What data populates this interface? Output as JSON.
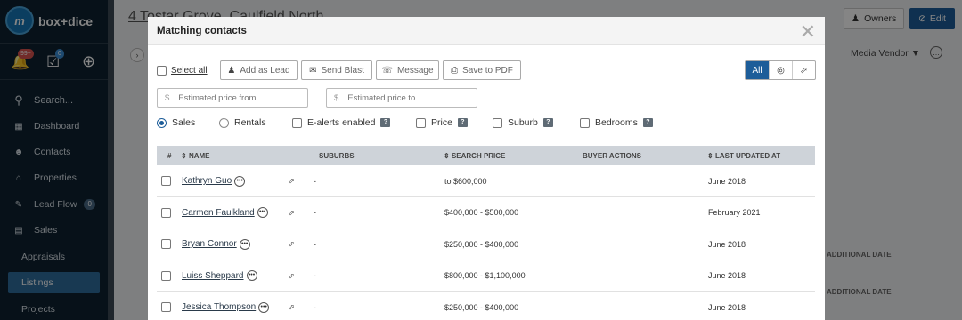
{
  "brand": {
    "logo_text": "m",
    "name": "box+dice"
  },
  "notifications": {
    "bell_count": "99+",
    "tasks_count": "0"
  },
  "sidebar": {
    "items": [
      {
        "label": "Search...",
        "icon": "search-icon"
      },
      {
        "label": "Dashboard",
        "icon": "dashboard-icon"
      },
      {
        "label": "Contacts",
        "icon": "contacts-icon"
      },
      {
        "label": "Properties",
        "icon": "home-icon"
      },
      {
        "label": "Lead Flow",
        "icon": "leadflow-icon",
        "count": "0"
      },
      {
        "label": "Sales",
        "icon": "sales-icon"
      }
    ],
    "subitems": [
      {
        "label": "Appraisals"
      },
      {
        "label": "Listings",
        "active": true
      },
      {
        "label": "Projects"
      }
    ]
  },
  "background": {
    "property_title": "4 Tostar Grove, Caulfield North",
    "owners_label": "Owners",
    "edit_label": "Edit",
    "media_vendor_label": "Media Vendor",
    "additional_date_1": "ADDITIONAL DATE",
    "additional_date_2": "ADDITIONAL DATE"
  },
  "modal": {
    "title": "Matching contacts",
    "select_all": "Select all",
    "buttons": {
      "add_as_lead": "Add as Lead",
      "send_blast": "Send Blast",
      "message": "Message",
      "save_pdf": "Save to PDF"
    },
    "filter_all": "All",
    "price_from_placeholder": "Estimated price from...",
    "price_to_placeholder": "Estimated price to...",
    "currency": "$",
    "options": {
      "sales": "Sales",
      "rentals": "Rentals",
      "ealerts": "E-alerts enabled",
      "price": "Price",
      "suburb": "Suburb",
      "bedrooms": "Bedrooms",
      "help": "?"
    },
    "table": {
      "columns": {
        "num": "#",
        "name": "NAME",
        "suburbs": "SUBURBS",
        "search_price": "SEARCH PRICE",
        "buyer_actions": "BUYER ACTIONS",
        "last_updated": "LAST UPDATED AT"
      },
      "rows": [
        {
          "name": "Kathryn Guo",
          "suburbs": "-",
          "price": "to $600,000",
          "updated": "June 2018"
        },
        {
          "name": "Carmen Faulkland",
          "suburbs": "-",
          "price": "$400,000 - $500,000",
          "updated": "February 2021"
        },
        {
          "name": "Bryan Connor",
          "suburbs": "-",
          "price": "$250,000 - $400,000",
          "updated": "June 2018"
        },
        {
          "name": "Luiss Sheppard",
          "suburbs": "-",
          "price": "$800,000 - $1,100,000",
          "updated": "June 2018"
        },
        {
          "name": "Jessica Thompson",
          "suburbs": "-",
          "price": "$250,000 - $400,000",
          "updated": "June 2018"
        }
      ]
    }
  },
  "colors": {
    "accent": "#1d5d99",
    "sidebar": "#0f2230",
    "badge_red": "#d9534f",
    "badge_blue": "#3a8fd6"
  }
}
